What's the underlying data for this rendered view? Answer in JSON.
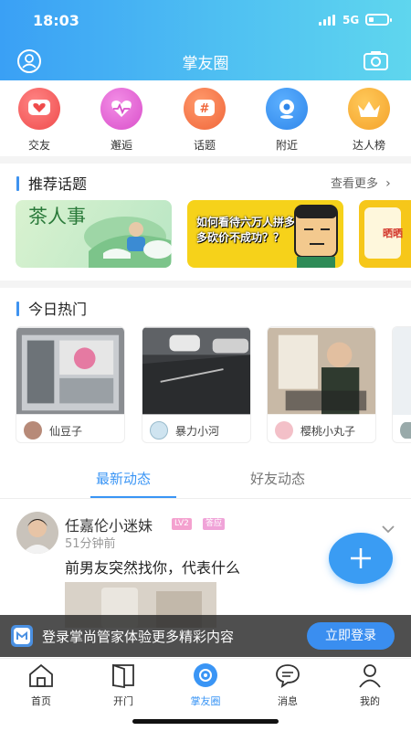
{
  "status_bar": {
    "time": "18:03",
    "network": "5G"
  },
  "header": {
    "title": "掌友圈"
  },
  "quick_links": [
    {
      "label": "交友",
      "icon": "heart-icon",
      "color": "#f25a5a"
    },
    {
      "label": "邂逅",
      "icon": "heartbeat-icon",
      "color": "#e565d6"
    },
    {
      "label": "话题",
      "icon": "hash-icon",
      "color": "#f37a4a"
    },
    {
      "label": "附近",
      "icon": "location-icon",
      "color": "#3a95f0"
    },
    {
      "label": "达人榜",
      "icon": "crown-icon",
      "color": "#f7b232"
    }
  ],
  "topics": {
    "title": "推荐话题",
    "more": "查看更多",
    "cards": [
      {
        "title": "茶人事"
      },
      {
        "title": "如何看待六万人拼多多砍价不成功？？"
      },
      {
        "title": "晒晒"
      }
    ]
  },
  "hot": {
    "title": "今日热门",
    "items": [
      {
        "author": "仙豆子"
      },
      {
        "author": "暴力小河"
      },
      {
        "author": "樱桃小丸子"
      }
    ]
  },
  "feed_tabs": {
    "latest": "最新动态",
    "friends": "好友动态"
  },
  "post": {
    "author": "任嘉伦小迷妹",
    "level": "LV2",
    "tag": "答应",
    "time": "51分钟前",
    "content": "前男友突然找你，代表什么"
  },
  "login_bar": {
    "text": "登录掌尚管家体验更多精彩内容",
    "button": "立即登录"
  },
  "bottom_nav": [
    {
      "label": "首页",
      "icon": "home-icon"
    },
    {
      "label": "开门",
      "icon": "door-icon"
    },
    {
      "label": "掌友圈",
      "icon": "circle-icon",
      "active": true
    },
    {
      "label": "消息",
      "icon": "message-icon"
    },
    {
      "label": "我的",
      "icon": "profile-icon"
    }
  ]
}
